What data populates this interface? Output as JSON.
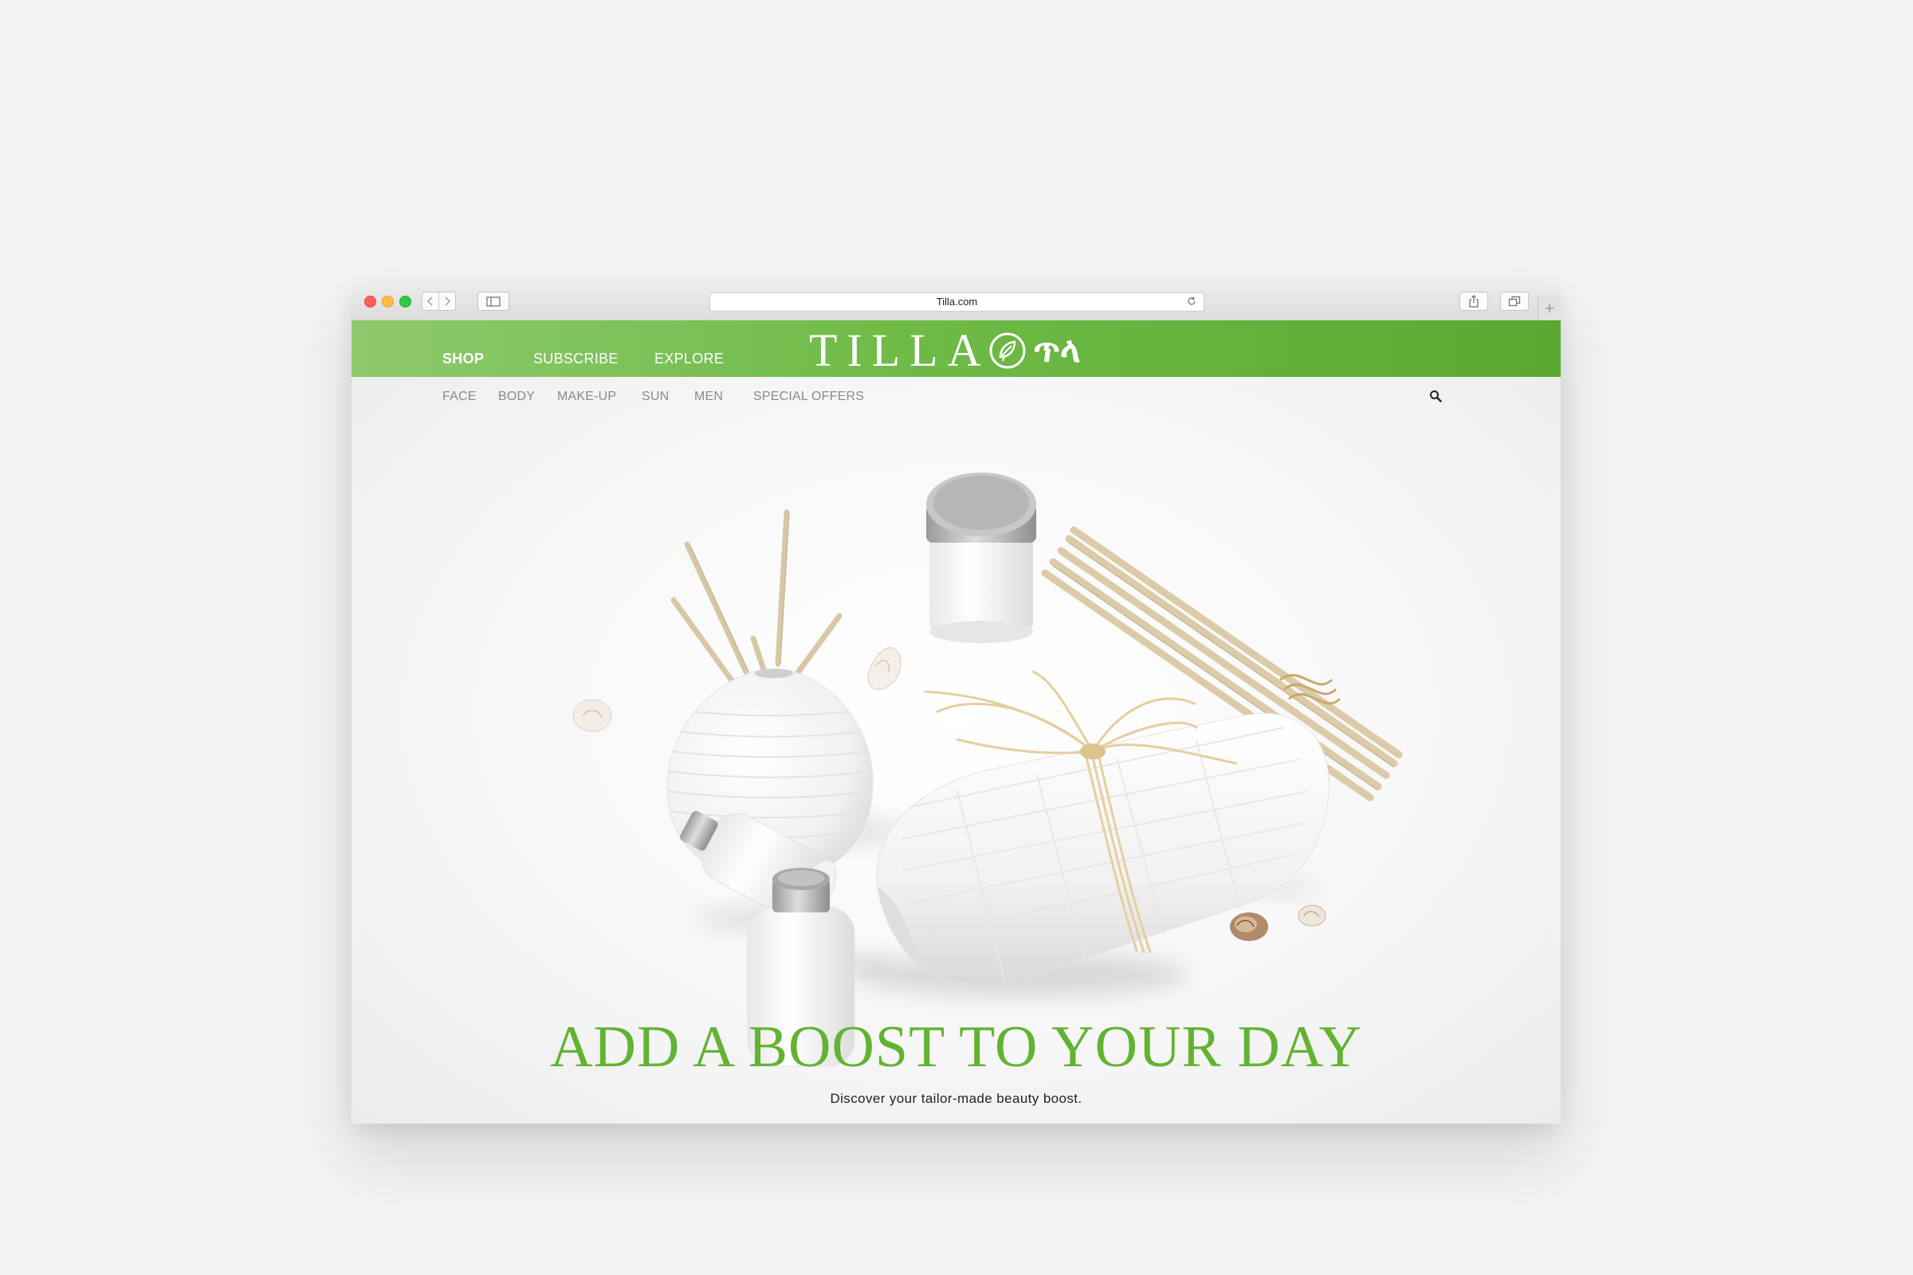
{
  "browser": {
    "url": "Tilla.com",
    "icons": [
      "back-arrow-icon",
      "forward-arrow-icon",
      "sidebar-icon",
      "reload-icon",
      "share-icon",
      "tabs-icon",
      "plus-icon"
    ]
  },
  "header": {
    "links": [
      "SHOP",
      "SUBSCRIBE",
      "EXPLORE"
    ],
    "active_link": "SHOP",
    "brand": "TILLA",
    "brand_ethiopic": "ጥላ",
    "background": "#6fbb47"
  },
  "categories": [
    "FACE",
    "BODY",
    "MAKE-UP",
    "SUN",
    "MEN",
    "SPECIAL OFFERS"
  ],
  "hero": {
    "headline": "ADD A BOOST TO YOUR DAY",
    "subheadline": "Discover your tailor-made beauty boost.",
    "headline_color": "#62b332"
  }
}
